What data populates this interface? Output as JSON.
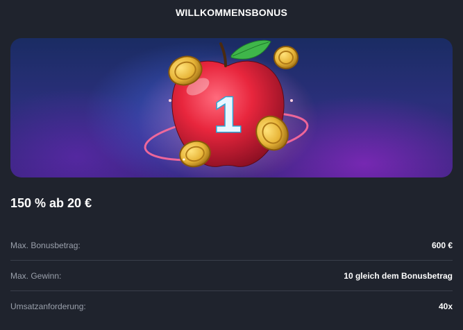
{
  "header": {
    "title": "WILLKOMMENSBONUS"
  },
  "banner": {
    "number": "1",
    "image_icon": "apple-coins-illustration"
  },
  "offer": {
    "headline": "150 % ab 20 €"
  },
  "details": [
    {
      "label": "Max. Bonusbetrag:",
      "value": "600 €"
    },
    {
      "label": "Max. Gewinn:",
      "value": "10 gleich dem Bonusbetrag"
    },
    {
      "label": "Umsatzanforderung:",
      "value": "40x"
    }
  ],
  "colors": {
    "background": "#1f232d",
    "apple": "#e8263d",
    "coin": "#e7b437",
    "leaf": "#3fb64a",
    "label": "#9aa0ab"
  }
}
